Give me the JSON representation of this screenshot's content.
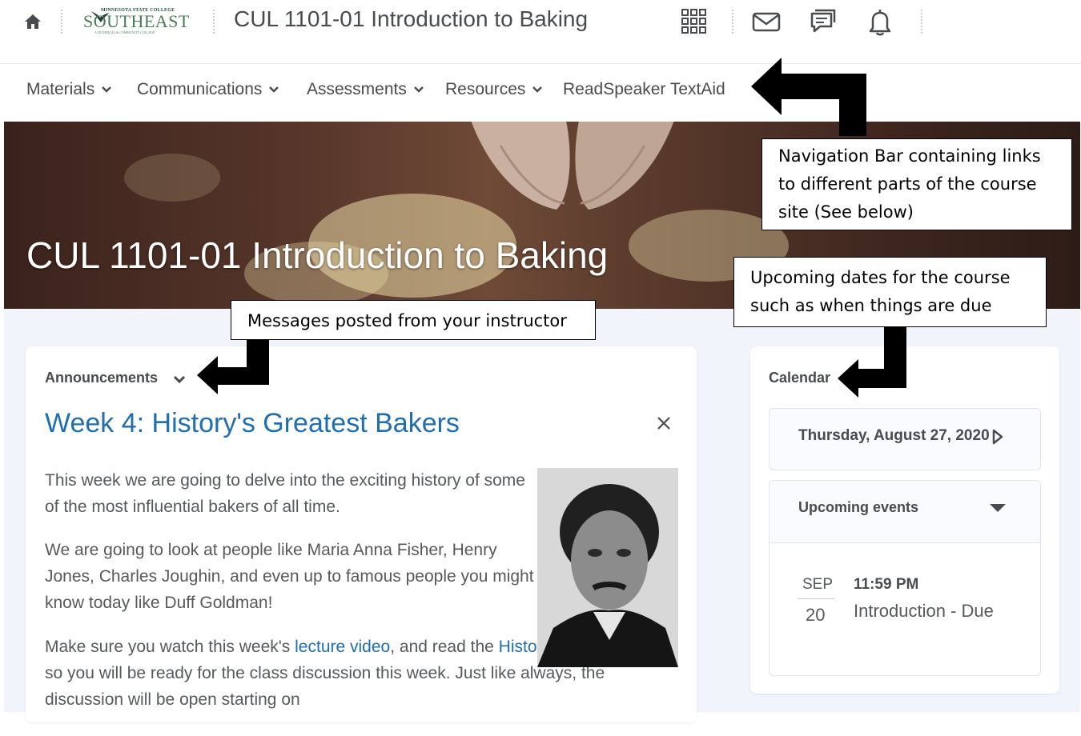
{
  "header": {
    "logo_small": "MINNESOTA STATE COLLEGE",
    "logo_big": "SOUTHEAST",
    "logo_tiny": "A TECHNICAL & COMMUNITY COLLEGE",
    "course_title": "CUL 1101-01 Introduction to Baking"
  },
  "nav": {
    "items": [
      {
        "label": "Materials",
        "has_menu": true
      },
      {
        "label": "Communications",
        "has_menu": true
      },
      {
        "label": "Assessments",
        "has_menu": true
      },
      {
        "label": "Resources",
        "has_menu": true
      },
      {
        "label": "ReadSpeaker TextAid",
        "has_menu": false
      }
    ]
  },
  "banner": {
    "title": "CUL 1101-01 Introduction to Baking"
  },
  "announcements": {
    "heading": "Announcements",
    "title": "Week 4: History's Greatest Bakers",
    "para1": "This week we are going to delve into the exciting history of some of the most influential bakers of all time.",
    "para2": "We are going to look at people like Maria Anna Fisher, Henry Jones, Charles Joughin, and even up to famous people you might know today like Duff Goldman!",
    "para3_pre": "Make sure you watch this week's ",
    "para3_link1": "lecture video",
    "para3_mid": ", and read the ",
    "para3_link2": "History Today article",
    "para3_post": " so you will be ready for the class discussion this week. Just like always, the discussion will be open starting on"
  },
  "calendar": {
    "heading": "Calendar",
    "date": "Thursday, August 27, 2020",
    "upcoming_label": "Upcoming events",
    "event": {
      "month": "SEP",
      "day": "20",
      "time": "11:59 PM",
      "name": "Introduction - Due"
    }
  },
  "callouts": {
    "nav": [
      "Navigation Bar containing links",
      "to different parts of the course",
      "site (See below)"
    ],
    "messages": "Messages posted from your instructor",
    "upcoming": [
      "Upcoming dates for the course",
      "such as when things are due"
    ]
  },
  "colors": {
    "link": "#1f6eb0",
    "page_bg": "#f1f5fb",
    "text": "#494c4e"
  }
}
